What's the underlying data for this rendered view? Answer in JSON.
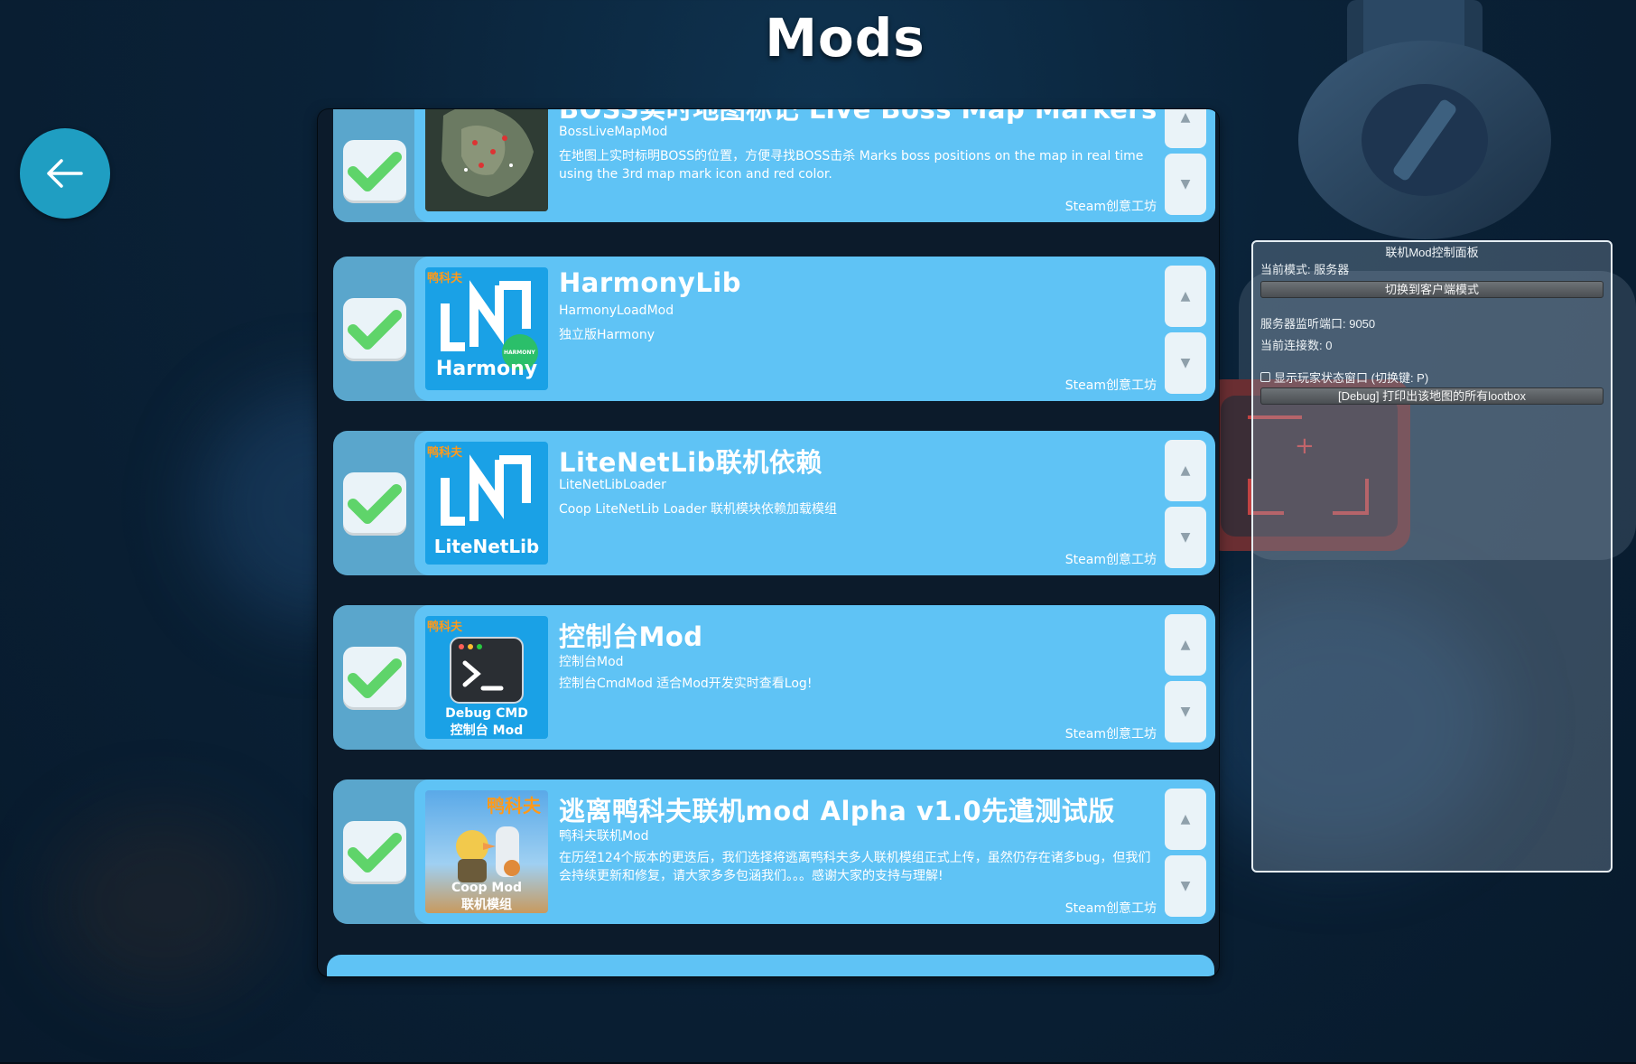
{
  "page": {
    "title": "Mods",
    "back_icon": "arrow-left-icon",
    "accent": "#1f9ec2",
    "card_color": "#5fc3f5"
  },
  "mods": [
    {
      "name": "BOSS实时地图标记 Live Boss Map Markers",
      "id": "BossLiveMapMod",
      "description": "在地图上实时标明BOSS的位置，方便寻找BOSS击杀 Marks boss positions on the map in real time using the 3rd map mark icon and red color.",
      "source": "Steam创意工坊",
      "enabled": true,
      "thumb": "map-thumbnail"
    },
    {
      "name": "HarmonyLib",
      "id": "HarmonyLoadMod",
      "description": "独立版Harmony",
      "source": "Steam创意工坊",
      "enabled": true,
      "thumb_tag": "鸭科夫",
      "thumb_caption": "Harmony",
      "thumb_badge": "HARMONY"
    },
    {
      "name": "LiteNetLib联机依赖",
      "id": "LiteNetLibLoader",
      "description": "Coop LiteNetLib Loader 联机模块依赖加载模组",
      "source": "Steam创意工坊",
      "enabled": true,
      "thumb_tag": "鸭科夫",
      "thumb_caption": "LiteNetLib"
    },
    {
      "name": "控制台Mod",
      "id": "控制台Mod",
      "description": "控制台CmdMod 适合Mod开发实时查看Log!",
      "source": "Steam创意工坊",
      "enabled": true,
      "thumb_tag": "鸭科夫",
      "thumb_caption_1": "Debug CMD",
      "thumb_caption_2": "控制台 Mod"
    },
    {
      "name": "逃离鸭科夫联机mod Alpha v1.0先遣测试版",
      "id": "鸭科夫联机Mod",
      "description": "在历经124个版本的更迭后，我们选择将逃离鸭科夫多人联机模组正式上传，虽然仍存在诸多bug，但我们会持续更新和修复，请大家多多包涵我们。。。感谢大家的支持与理解!",
      "source": "Steam创意工坊",
      "enabled": true,
      "thumb_tag": "鸭科夫",
      "thumb_caption_1": "Coop Mod",
      "thumb_caption_2": "联机模组"
    }
  ],
  "panel": {
    "title": "联机Mod控制面板",
    "mode": "当前模式: 服务器",
    "switch_button": "切换到客户端模式",
    "port": "服务器监听端口: 9050",
    "connections": "当前连接数: 0",
    "toggle_label": "显示玩家状态窗口 (切换键: P)",
    "debug_button": "[Debug] 打印出该地图的所有lootbox"
  }
}
